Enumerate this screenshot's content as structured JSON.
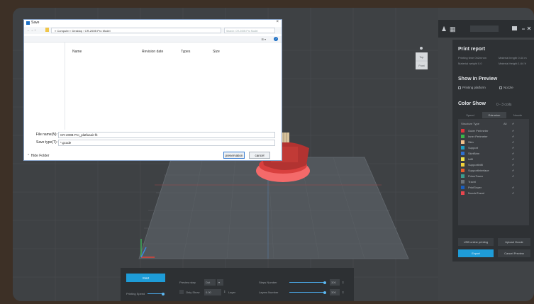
{
  "dialog": {
    "title": "Save",
    "close": "×",
    "nav": "←  →  ↑",
    "path": "« Computer › Desktop › CR-200B Pro Model",
    "search_placeholder": "Search: CR-200B Pro Model",
    "view_label": "⊞ ▾",
    "help": "?",
    "columns": [
      "Name",
      "Revision date",
      "Types",
      "Size"
    ],
    "file_name_label": "File name(N):",
    "file_name_value": "CR-200B Pro_platfusair-fit",
    "save_type_label": "Save type(T):",
    "save_type_value": "*.gcode",
    "hide_folder": "⌃ Hide Folder",
    "save_button": "preservation",
    "cancel_button": "cancel"
  },
  "topbar": {
    "user_icon": "♟",
    "box_icon": "▦",
    "field_text": ""
  },
  "panel": {
    "print_report": "Print report",
    "printing_time": "Printing time 0h2mnnn",
    "material_length": "Material length 0.44 m",
    "material_weight": "Material weight 0.0",
    "material_cost": "Material freight 1.64 ¥",
    "show_in_preview": "Show in Preview",
    "printing_platform": "Printing platform",
    "nozzle": "Nozzle",
    "color_show": "Color Show",
    "color_range": "0 - 3 coils",
    "tabs": [
      "Speed",
      "Extrusion",
      "Nozzle"
    ],
    "structure_type": "Structure Type",
    "all_label": "All",
    "legend": [
      {
        "label": "Outer Perimeter",
        "color": "#e0343c"
      },
      {
        "label": "Inner Perimeter",
        "color": "#3ab54a"
      },
      {
        "label": "Skin",
        "color": "#f2c089"
      },
      {
        "label": "Support",
        "color": "#1fa0c4"
      },
      {
        "label": "SkirtBrim",
        "color": "#2e6fcf"
      },
      {
        "label": "Infill",
        "color": "#f0e14a"
      },
      {
        "label": "SupportInfill",
        "color": "#f0d23a"
      },
      {
        "label": "SupportInterface",
        "color": "#eb5a2a"
      },
      {
        "label": "PrimeTower",
        "color": "#3c9c8e"
      },
      {
        "label": "Travel",
        "color": "#6d7378"
      },
      {
        "label": "PrintTower",
        "color": "#1a5fbf"
      },
      {
        "label": "NozzleTravel",
        "color": "#e8464e"
      }
    ],
    "usb_button": "USB online printing",
    "upload_button": "Upload Gcode",
    "export_button": "Export",
    "cancel_preview": "Cancel Preview"
  },
  "bottom": {
    "start_button": "Start",
    "printing_speed": "Printing Speed",
    "preview_step": "Preview step",
    "step_value": "Dot",
    "only_show": "Only Show",
    "only_value": "0.00",
    "layer_label": "Layer",
    "steps_number": "Steps Number",
    "steps_value": "300",
    "layers_number": "Layers Number",
    "layers_value": "300"
  },
  "navcube": {
    "top_label": "Top",
    "front_label": "Front"
  }
}
